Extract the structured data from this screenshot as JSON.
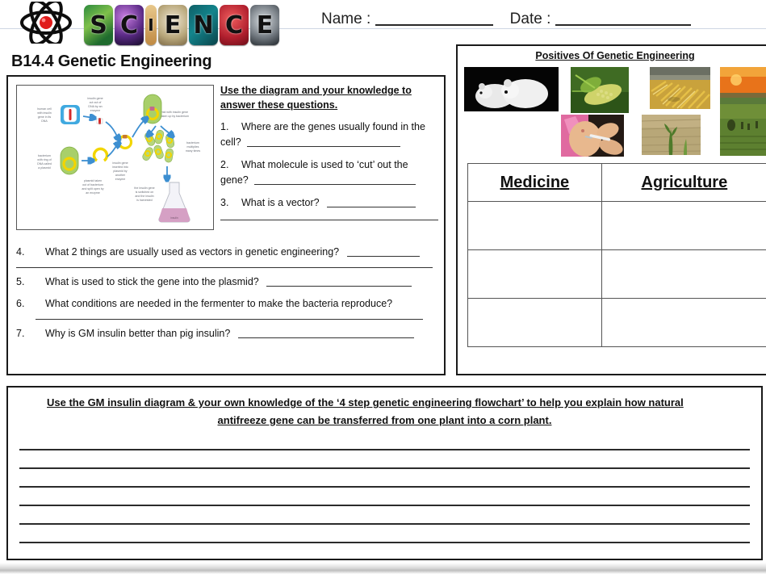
{
  "header": {
    "logo_alt": "science-logo",
    "logo_letters": [
      "S",
      "C",
      "I",
      "E",
      "N",
      "C",
      "E"
    ],
    "name_label": "Name :",
    "date_label": "Date :"
  },
  "document": {
    "title": "B14.4 Genetic Engineering"
  },
  "left_panel": {
    "diagram_name": "gm-insulin-diagram",
    "diagram_labels": [
      "human cell with insulin gene in its DNA",
      "insulin gene cut out of DNA by an enzyme",
      "bacterium with ring of DNA called a plasmid",
      "plasmid taken out of bacterium and split open by an enzyme",
      "insulin gene inserted into plasmid by another enzyme",
      "plasmid with insulin gene in it taken up by bacterium",
      "bacterium multiplies many times",
      "the insulin gene is switched on and the insulin is harvested",
      "insulin"
    ],
    "instruction": "Use the diagram and your knowledge to answer these questions.",
    "questions_top": [
      {
        "num": "1.",
        "text": "Where are the genes usually found in the cell?"
      },
      {
        "num": "2.",
        "text": "What molecule is used to ‘cut’ out the gene?"
      },
      {
        "num": "3.",
        "text": "What is a vector?"
      }
    ],
    "questions_bottom": [
      {
        "num": "4.",
        "text": "What 2 things are usually used as vectors in genetic engineering?"
      },
      {
        "num": "5.",
        "text": "What is used to stick the gene into the plasmid?"
      },
      {
        "num": "6.",
        "text": "What conditions are needed in the fermenter to make the bacteria reproduce?"
      },
      {
        "num": "7.",
        "text": "Why is GM insulin better than pig insulin?"
      }
    ]
  },
  "right_panel": {
    "title": "Positives Of Genetic Engineering",
    "photos": [
      {
        "name": "photo-gm-mice",
        "caption": "two white mice on black background"
      },
      {
        "name": "photo-corn-cob",
        "caption": "green corn cob on plant"
      },
      {
        "name": "photo-harvested-corn",
        "caption": "pile of harvested yellow corn"
      },
      {
        "name": "photo-rice-paddy",
        "caption": "rice paddy field at sunset"
      },
      {
        "name": "photo-vaccination",
        "caption": "child receiving an injection"
      },
      {
        "name": "photo-drought-crop",
        "caption": "crop seedling in dry soil"
      }
    ],
    "table": {
      "headers": [
        "Medicine",
        "Agriculture"
      ],
      "rows": [
        [
          "",
          ""
        ],
        [
          "",
          ""
        ],
        [
          "",
          ""
        ]
      ]
    }
  },
  "bottom_panel": {
    "instruction_line1": "Use the GM insulin diagram & your own knowledge of the ‘4 step genetic engineering flowchart’ to help you explain how natural",
    "instruction_line2": "antifreeze gene can be transferred from one plant into a corn plant.",
    "answer_line_count": 6
  },
  "colors": {
    "border": "#1a1a1a",
    "rule": "#2b2b2b",
    "atom_nucleus": "#e01b1b",
    "text": "#111111"
  }
}
